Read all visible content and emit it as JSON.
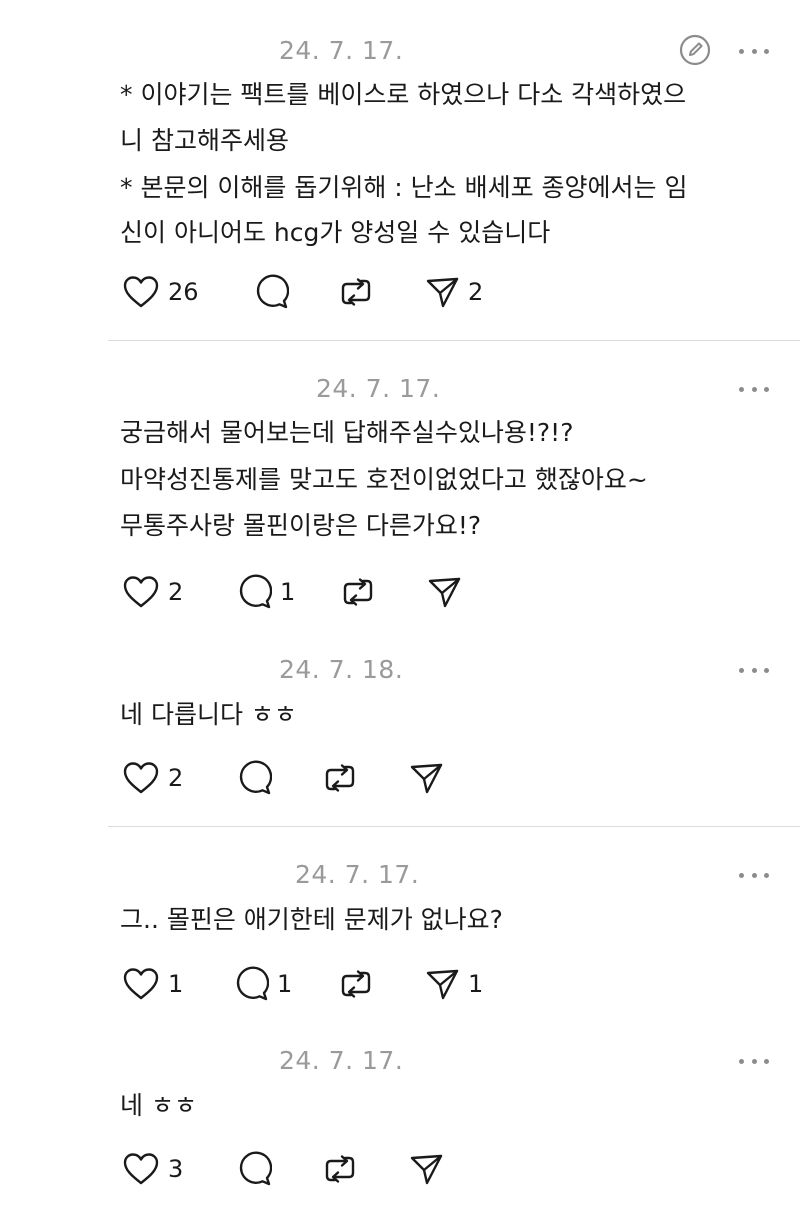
{
  "posts": [
    {
      "date": "24. 7. 17.",
      "lines": [
        "* 이야기는 팩트를 베이스로 하였으나 다소 각색하였으",
        "니 참고해주세용",
        "* 본문의 이해를 돕기위해 : 난소 배세포 종양에서는 임",
        "신이 아니어도 hcg가 양성일 수 있습니다"
      ],
      "likes": "26",
      "replies": "",
      "reposts": "",
      "shares": "2"
    },
    {
      "date": "24. 7. 17.",
      "lines": [
        "궁금해서 물어보는데 답해주실수있나용!?!?",
        "마약성진통제를 맞고도 호전이없었다고 했잖아요~",
        "무통주사랑 몰핀이랑은 다른가요!?"
      ],
      "likes": "2",
      "replies": "1",
      "reposts": "",
      "shares": ""
    },
    {
      "date": "24. 7. 18.",
      "lines": [
        "네 다릅니다 ㅎㅎ"
      ],
      "likes": "2",
      "replies": "",
      "reposts": "",
      "shares": ""
    },
    {
      "date": "24. 7. 17.",
      "lines": [
        "그.. 몰핀은 애기한테 문제가 없나요?"
      ],
      "likes": "1",
      "replies": "1",
      "reposts": "",
      "shares": "1"
    },
    {
      "date": "24. 7. 17.",
      "lines": [
        "네 ㅎㅎ"
      ],
      "likes": "3",
      "replies": "",
      "reposts": "",
      "shares": ""
    }
  ],
  "icons": {
    "like": "heart-icon",
    "reply": "speech-bubble-icon",
    "repost": "repost-icon",
    "share": "send-icon",
    "more": "more-horizontal-icon",
    "edit": "edit-icon"
  }
}
